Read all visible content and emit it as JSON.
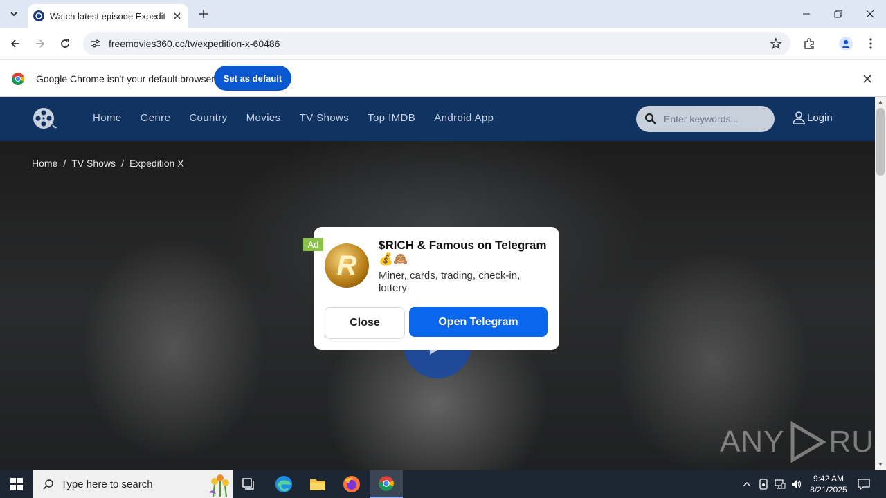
{
  "browser": {
    "tab_title": "Watch latest episode Expedition X",
    "url": "freemovies360.cc/tv/expedition-x-60486",
    "infobar_text": "Google Chrome isn't your default browser",
    "set_default_label": "Set as default"
  },
  "site": {
    "nav": [
      "Home",
      "Genre",
      "Country",
      "Movies",
      "TV Shows",
      "Top IMDB",
      "Android App"
    ],
    "search_placeholder": "Enter keywords...",
    "login_label": "Login",
    "breadcrumb": [
      "Home",
      "TV Shows",
      "Expedition X"
    ],
    "breadcrumb_sep": "/"
  },
  "ad": {
    "label": "Ad",
    "title": "$RICH & Famous on Telegram",
    "emoji": "💰🙈",
    "description": "Miner, cards, trading, check-in, lottery",
    "close_label": "Close",
    "open_label": "Open Telegram",
    "logo_letter": "R"
  },
  "watermark": {
    "left": "ANY",
    "right": "RUN"
  },
  "taskbar": {
    "search_text": "Type here to search",
    "time": "9:42 AM",
    "date": "8/21/2025"
  },
  "colors": {
    "site_header": "#103362",
    "accent": "#0b57d0",
    "ad_button": "#0b66ee"
  }
}
